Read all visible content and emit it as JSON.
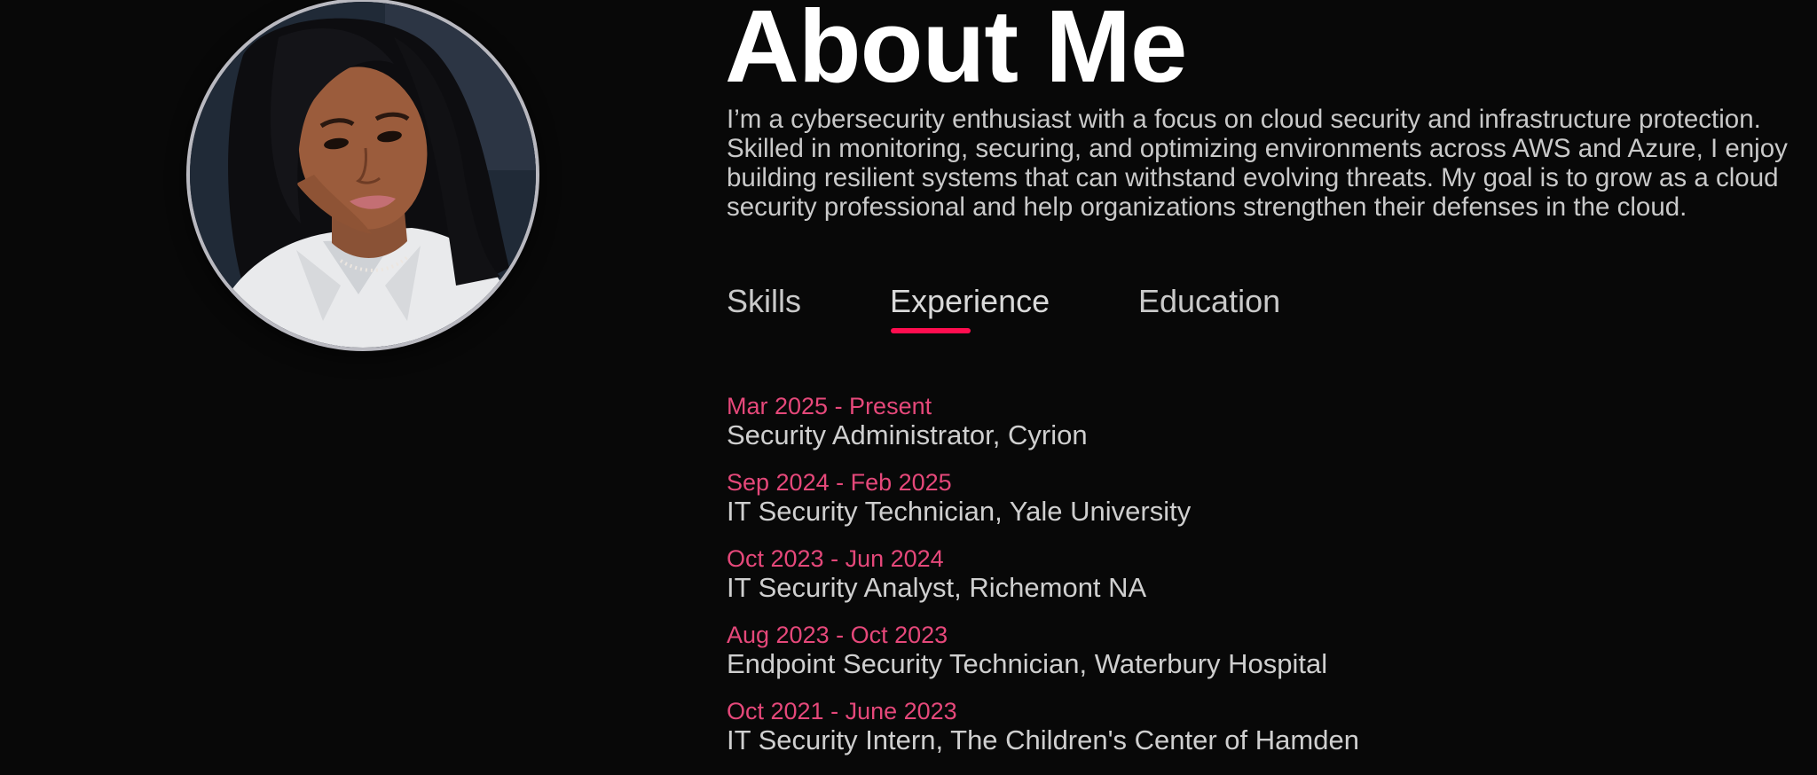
{
  "about": {
    "title": "About Me",
    "bio": "I’m a cybersecurity enthusiast with a focus on cloud security and infrastructure protection. Skilled in monitoring, securing, and optimizing environments across AWS and Azure, I enjoy building resilient systems that can withstand evolving threats. My goal is to grow as a cloud security professional and help organizations strengthen their defenses in the cloud."
  },
  "tabs": [
    {
      "label": "Skills",
      "active": false
    },
    {
      "label": "Experience",
      "active": true
    },
    {
      "label": "Education",
      "active": false
    }
  ],
  "experience": [
    {
      "date": "Mar 2025 - Present",
      "role": "Security Administrator, Cyrion"
    },
    {
      "date": "Sep 2024 - Feb 2025",
      "role": "IT Security Technician, Yale University"
    },
    {
      "date": "Oct 2023 - Jun 2024",
      "role": "IT Security Analyst, Richemont NA"
    },
    {
      "date": "Aug 2023 - Oct 2023",
      "role": "Endpoint Security Technician, Waterbury Hospital"
    },
    {
      "date": "Oct 2021 - June 2023",
      "role": "IT Security Intern, The Children's Center of Hamden"
    }
  ],
  "colors": {
    "background": "#080808",
    "accent": "#ff0d4f",
    "date_text": "#e5487a",
    "body_text": "#c9c9c9"
  }
}
